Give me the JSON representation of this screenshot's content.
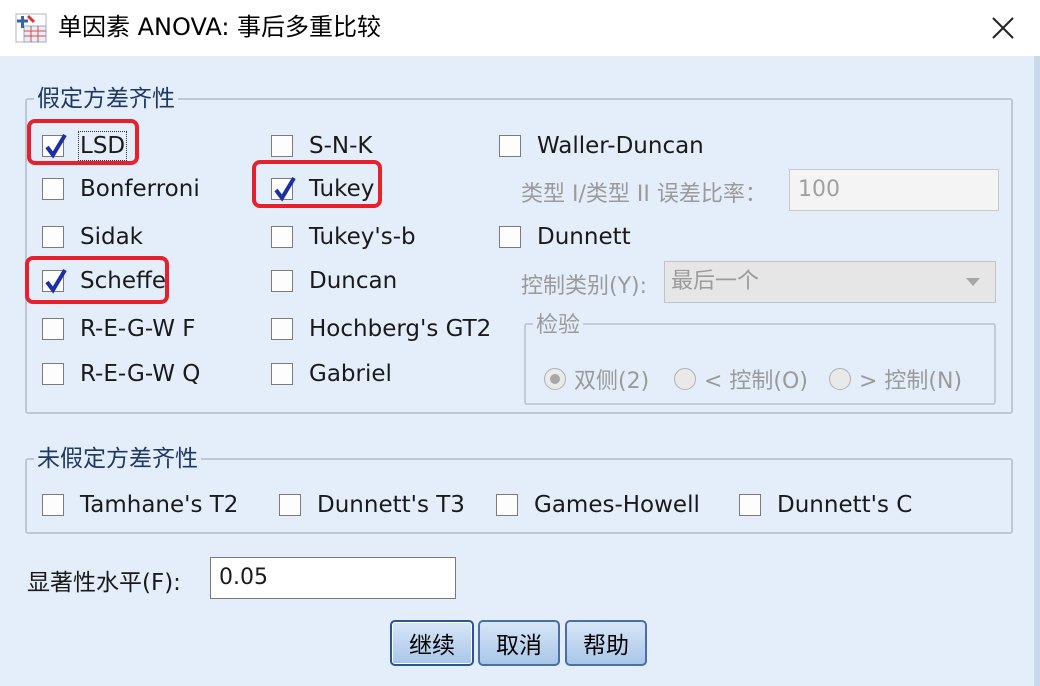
{
  "window": {
    "title": "单因素 ANOVA: 事后多重比较"
  },
  "equal_variance": {
    "legend": "假定方差齐性",
    "col1": [
      {
        "label": "LSD",
        "checked": true,
        "highlighted": true
      },
      {
        "label": "Bonferroni",
        "checked": false
      },
      {
        "label": "Sidak",
        "checked": false
      },
      {
        "label": "Scheffe",
        "checked": true,
        "highlighted": true
      },
      {
        "label": "R-E-G-W F",
        "checked": false
      },
      {
        "label": "R-E-G-W Q",
        "checked": false
      }
    ],
    "col2": [
      {
        "label": "S-N-K",
        "checked": false
      },
      {
        "label": "Tukey",
        "checked": true,
        "highlighted": true
      },
      {
        "label": "Tukey's-b",
        "checked": false
      },
      {
        "label": "Duncan",
        "checked": false
      },
      {
        "label": "Hochberg's GT2",
        "checked": false
      },
      {
        "label": "Gabriel",
        "checked": false
      }
    ],
    "waller_duncan": {
      "label": "Waller-Duncan",
      "checked": false,
      "ratio_label": "类型 I/类型 II 误差比率：",
      "ratio_value": "100"
    },
    "dunnett": {
      "label": "Dunnett",
      "checked": false,
      "control_label": "控制类别(Y):",
      "control_value": "最后一个",
      "test_legend": "检验",
      "radios": [
        {
          "label": "双侧(2)",
          "selected": true
        },
        {
          "label": "< 控制(O)",
          "selected": false
        },
        {
          "label": "> 控制(N)",
          "selected": false
        }
      ]
    }
  },
  "unequal_variance": {
    "legend": "未假定方差齐性",
    "items": [
      {
        "label": "Tamhane's T2",
        "checked": false
      },
      {
        "label": "Dunnett's T3",
        "checked": false
      },
      {
        "label": "Games-Howell",
        "checked": false
      },
      {
        "label": "Dunnett's C",
        "checked": false
      }
    ]
  },
  "significance": {
    "label": "显著性水平(F):",
    "value": "0.05"
  },
  "buttons": {
    "continue": "继续",
    "cancel": "取消",
    "help": "帮助"
  },
  "colors": {
    "dialog_bg": "#e3eefa",
    "highlight": "#e8202c",
    "check": "#1a2fa8"
  }
}
